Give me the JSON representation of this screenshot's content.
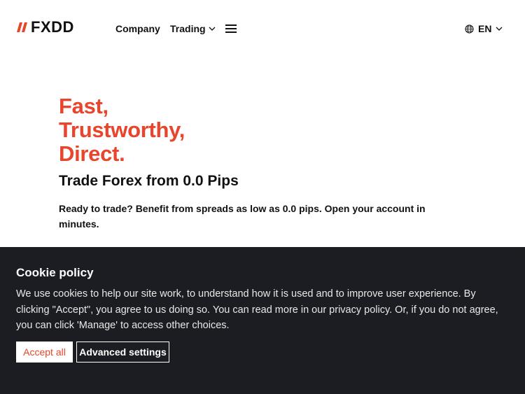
{
  "header": {
    "logo_text": "FXDD",
    "nav": {
      "company": "Company",
      "trading": "Trading"
    },
    "language": "EN"
  },
  "hero": {
    "title_lines": [
      "Fast,",
      "Trustworthy,",
      "Direct."
    ],
    "subtitle": "Trade Forex from 0.0 Pips",
    "description": "Ready to trade? Benefit from spreads as low as 0.0 pips. Open your account in minutes."
  },
  "cookie": {
    "title": "Cookie policy",
    "text": "We use cookies to help our site work, to understand how it is used and to improve user experience. By clicking \"Accept\", you agree to us doing so. You can read more in our privacy policy. Or, if you do not agree, you can click 'Manage' to access other choices.",
    "accept_label": "Accept all",
    "advanced_label": "Advanced settings"
  },
  "colors": {
    "brand_red": "#e8452c",
    "banner_bg": "#1b1d22"
  },
  "icons": {
    "logo": "fxdd-slashes-logo-icon",
    "menu": "hamburger-menu-icon",
    "language": "globe-icon",
    "dropdown": "chevron-down-icon"
  }
}
